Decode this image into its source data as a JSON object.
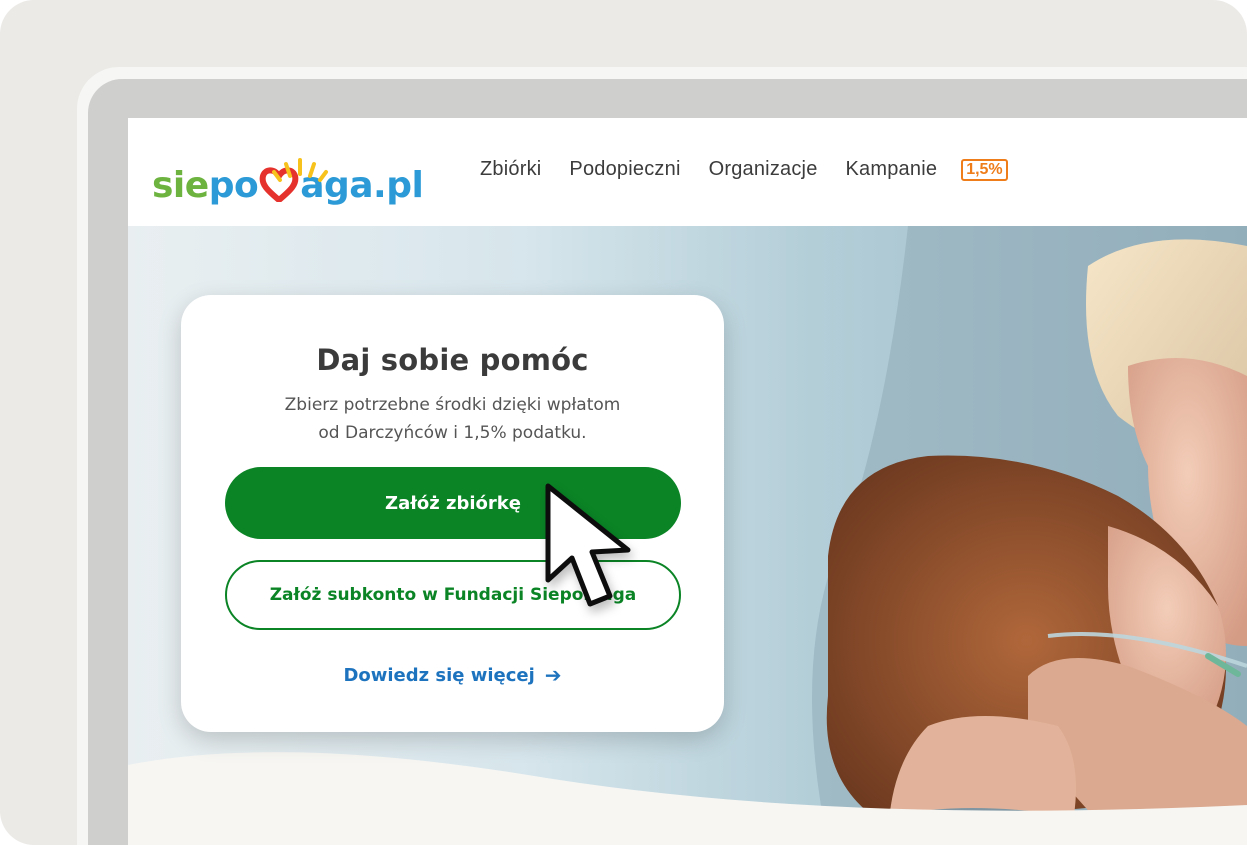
{
  "header": {
    "logo": {
      "part1": "sie",
      "part2": "po",
      "part3": "aga.pl"
    },
    "nav": [
      "Zbiórki",
      "Podopieczni",
      "Organizacje",
      "Kampanie"
    ],
    "badge": "1,5%"
  },
  "card": {
    "title": "Daj sobie pomóc",
    "subtitle_line1": "Zbierz potrzebne środki dzięki wpłatom",
    "subtitle_line2": "od Darczyńców i 1,5% podatku.",
    "primary_button": "Załóż zbiórkę",
    "secondary_button": "Załóż subkonto w Fundacji Siepomaga",
    "learn_more": "Dowiedz się więcej",
    "learn_more_icon": "arrow-right-icon"
  },
  "colors": {
    "brand_green": "#0a8425",
    "link_blue": "#1e73be",
    "badge_orange": "#ee7d1a",
    "logo_green": "#6cb33f",
    "logo_blue": "#2b9ad6",
    "logo_heart": "#e6322c"
  }
}
